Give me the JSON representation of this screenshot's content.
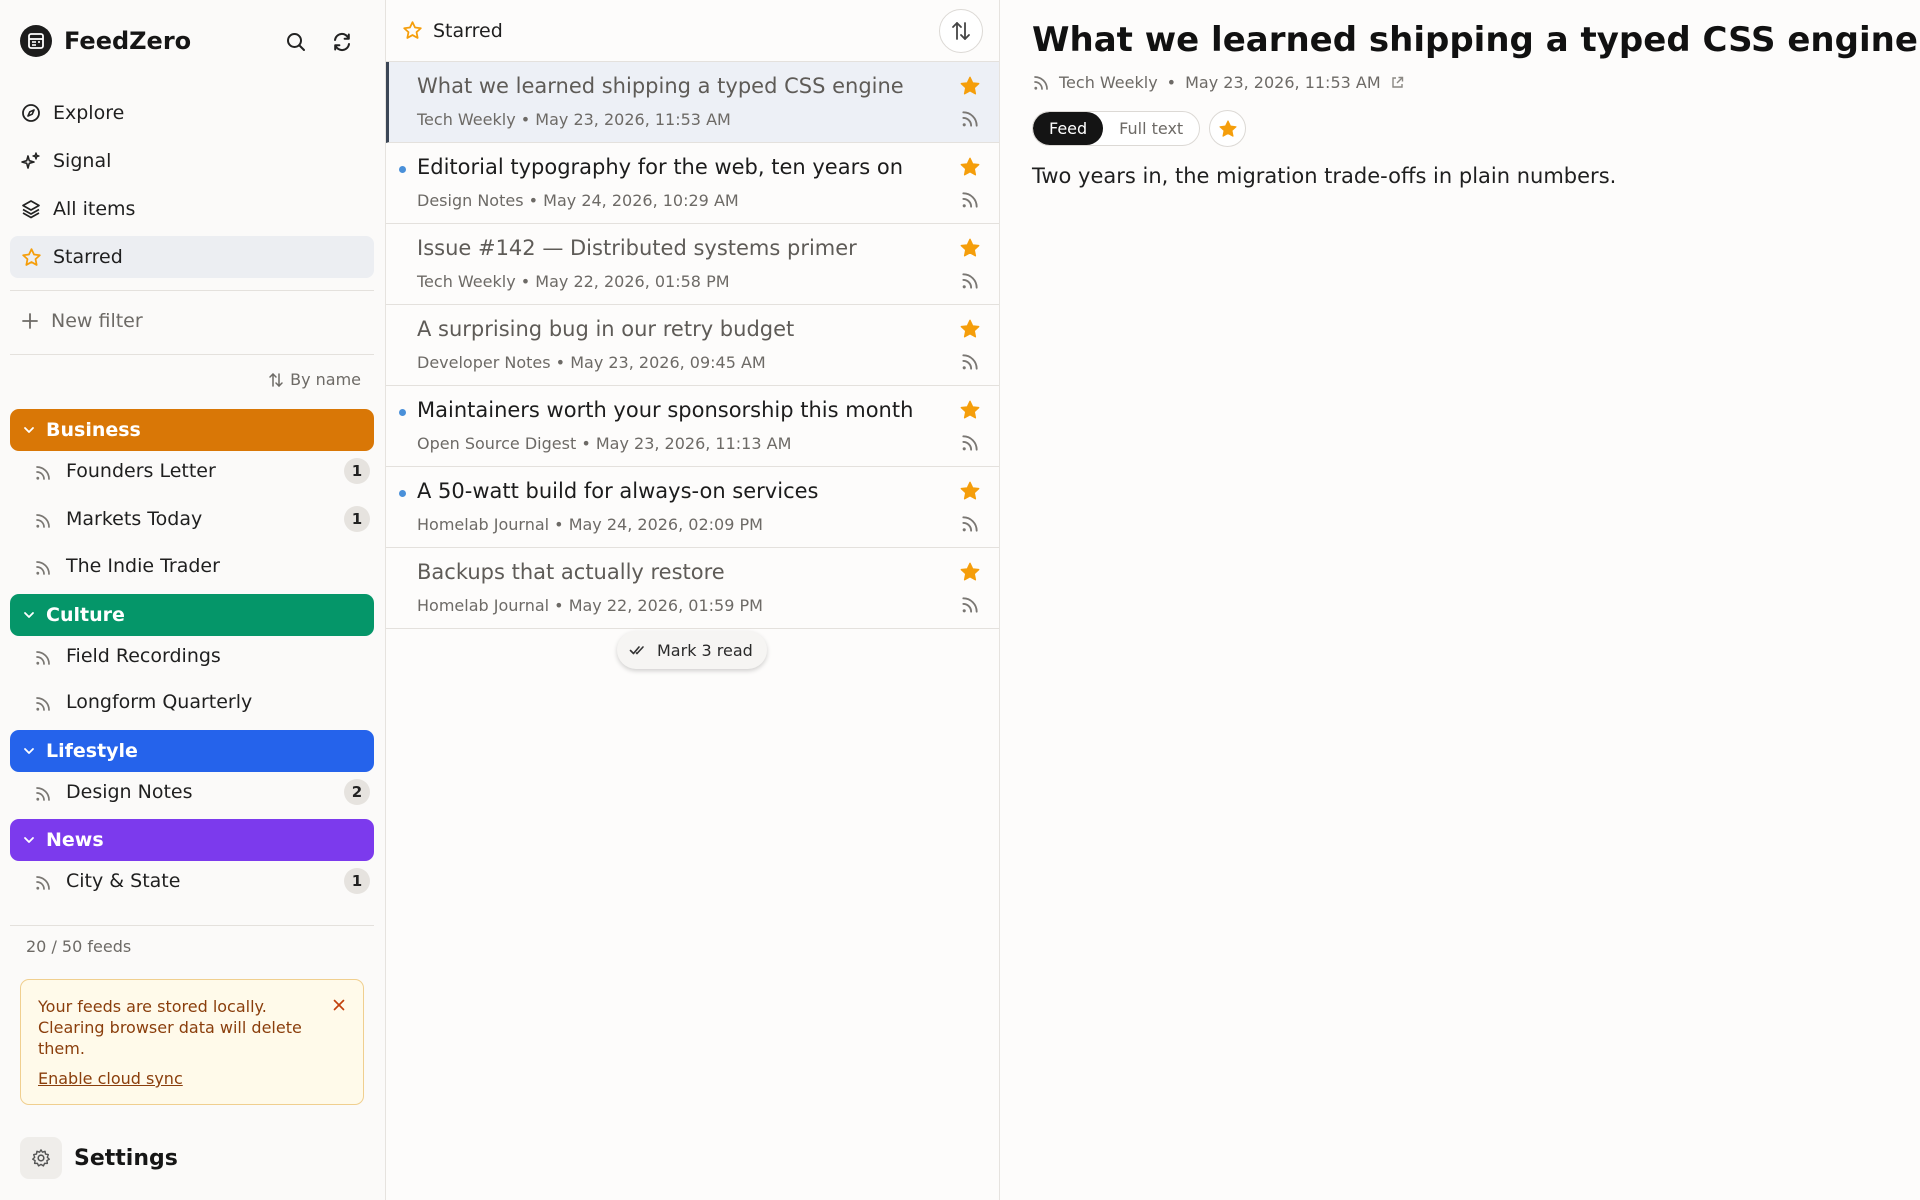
{
  "brand": {
    "name": "FeedZero"
  },
  "sidebar": {
    "nav": [
      {
        "label": "Explore",
        "icon": "compass-icon"
      },
      {
        "label": "Signal",
        "icon": "sparkle-icon"
      },
      {
        "label": "All items",
        "icon": "layers-icon"
      },
      {
        "label": "Starred",
        "icon": "star-outline-icon",
        "active": true
      }
    ],
    "new_filter": "New filter",
    "sort_label": "By name",
    "groups": [
      {
        "name": "Business",
        "color": "#d97706",
        "feeds": [
          {
            "name": "Founders Letter",
            "count": "1"
          },
          {
            "name": "Markets Today",
            "count": "1"
          },
          {
            "name": "The Indie Trader",
            "count": ""
          }
        ]
      },
      {
        "name": "Culture",
        "color": "#059669",
        "feeds": [
          {
            "name": "Field Recordings",
            "count": ""
          },
          {
            "name": "Longform Quarterly",
            "count": ""
          }
        ]
      },
      {
        "name": "Lifestyle",
        "color": "#2563eb",
        "feeds": [
          {
            "name": "Design Notes",
            "count": "2"
          }
        ]
      },
      {
        "name": "News",
        "color": "#7c3aed",
        "feeds": [
          {
            "name": "City & State",
            "count": "1"
          }
        ]
      }
    ],
    "feed_count": "20 / 50 feeds",
    "notice": {
      "text": "Your feeds are stored locally. Clearing browser data will delete them.",
      "link": "Enable cloud sync"
    },
    "settings_label": "Settings"
  },
  "list": {
    "header": "Starred",
    "articles": [
      {
        "title": "What we learned shipping a typed CSS engine",
        "source": "Tech Weekly",
        "date": "May 23, 2026, 11:53 AM",
        "unread": false,
        "selected": true
      },
      {
        "title": "Editorial typography for the web, ten years on",
        "source": "Design Notes",
        "date": "May 24, 2026, 10:29 AM",
        "unread": true,
        "selected": false
      },
      {
        "title": "Issue #142 — Distributed systems primer",
        "source": "Tech Weekly",
        "date": "May 22, 2026, 01:58 PM",
        "unread": false,
        "selected": false
      },
      {
        "title": "A surprising bug in our retry budget",
        "source": "Developer Notes",
        "date": "May 23, 2026, 09:45 AM",
        "unread": false,
        "selected": false
      },
      {
        "title": "Maintainers worth your sponsorship this month",
        "source": "Open Source Digest",
        "date": "May 23, 2026, 11:13 AM",
        "unread": true,
        "selected": false
      },
      {
        "title": "A 50-watt build for always-on services",
        "source": "Homelab Journal",
        "date": "May 24, 2026, 02:09 PM",
        "unread": true,
        "selected": false
      },
      {
        "title": "Backups that actually restore",
        "source": "Homelab Journal",
        "date": "May 22, 2026, 01:59 PM",
        "unread": false,
        "selected": false
      }
    ],
    "mark_read": "Mark 3 read"
  },
  "reader": {
    "title": "What we learned shipping a typed CSS engine",
    "source": "Tech Weekly",
    "date": "May 23, 2026, 11:53 AM",
    "view_options": [
      "Feed",
      "Full text"
    ],
    "active_view": "Feed",
    "body": "Two years in, the migration trade-offs in plain numbers."
  },
  "colors": {
    "star": "#f59e0b",
    "unread_dot": "#4a90d9"
  }
}
